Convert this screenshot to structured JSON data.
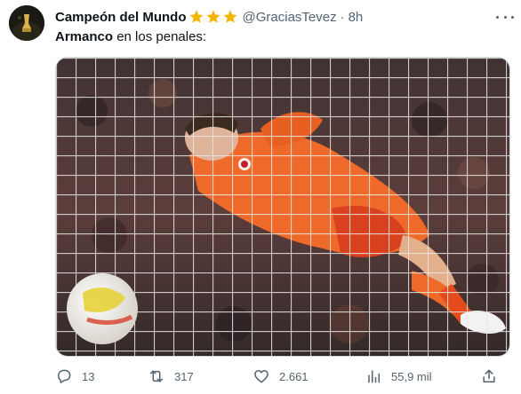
{
  "tweet": {
    "display_name": "Campeón del Mundo",
    "badges": [
      "star-icon",
      "star-icon",
      "star-icon"
    ],
    "handle": "@GraciasTevez",
    "separator": "·",
    "time": "8h",
    "text_bold": "Armanco",
    "text_rest": " en los penales:"
  },
  "actions": {
    "reply_count": "13",
    "retweet_count": "317",
    "like_count": "2.661",
    "views_count": "55,9 mil"
  },
  "colors": {
    "star": "#f5b400",
    "secondary_text": "#536471",
    "jersey": "#f06a2c"
  }
}
